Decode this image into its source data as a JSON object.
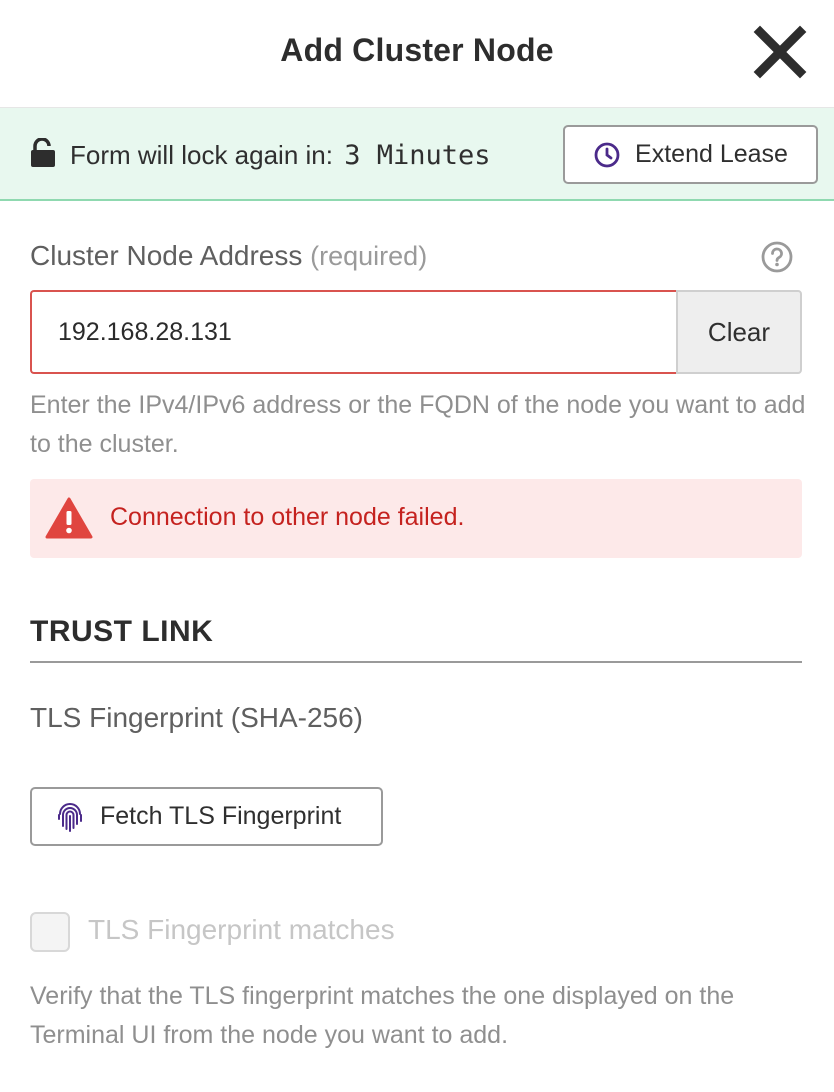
{
  "dialog": {
    "title": "Add Cluster Node"
  },
  "lease": {
    "label": "Form will lock again in:",
    "time": "3 Minutes",
    "extend_label": "Extend Lease",
    "background_color": "#e8f8ef"
  },
  "address": {
    "label": "Cluster Node Address",
    "required_text": "(required)",
    "value": "192.168.28.131",
    "clear_label": "Clear",
    "hint": "Enter the IPv4/IPv6 address or the FQDN of the node you want to add to the cluster."
  },
  "error": {
    "message": "Connection to other node failed.",
    "color": "#c5221f"
  },
  "trust_link": {
    "title": "TRUST LINK",
    "fingerprint_label": "TLS Fingerprint (SHA-256)",
    "fetch_label": "Fetch TLS Fingerprint",
    "checkbox_label": "TLS Fingerprint matches",
    "checkbox_checked": false,
    "checkbox_disabled": true,
    "verify_hint": "Verify that the TLS fingerprint matches the one displayed on the Terminal UI from the node you want to add."
  },
  "icons": {
    "close": "close-icon",
    "lock": "unlock-icon",
    "clock": "clock-icon",
    "help": "question-circle-icon",
    "warning": "warning-triangle-icon",
    "fingerprint": "fingerprint-icon"
  },
  "colors": {
    "accent_purple": "#4b2a8a",
    "error_red": "#e0453f"
  }
}
